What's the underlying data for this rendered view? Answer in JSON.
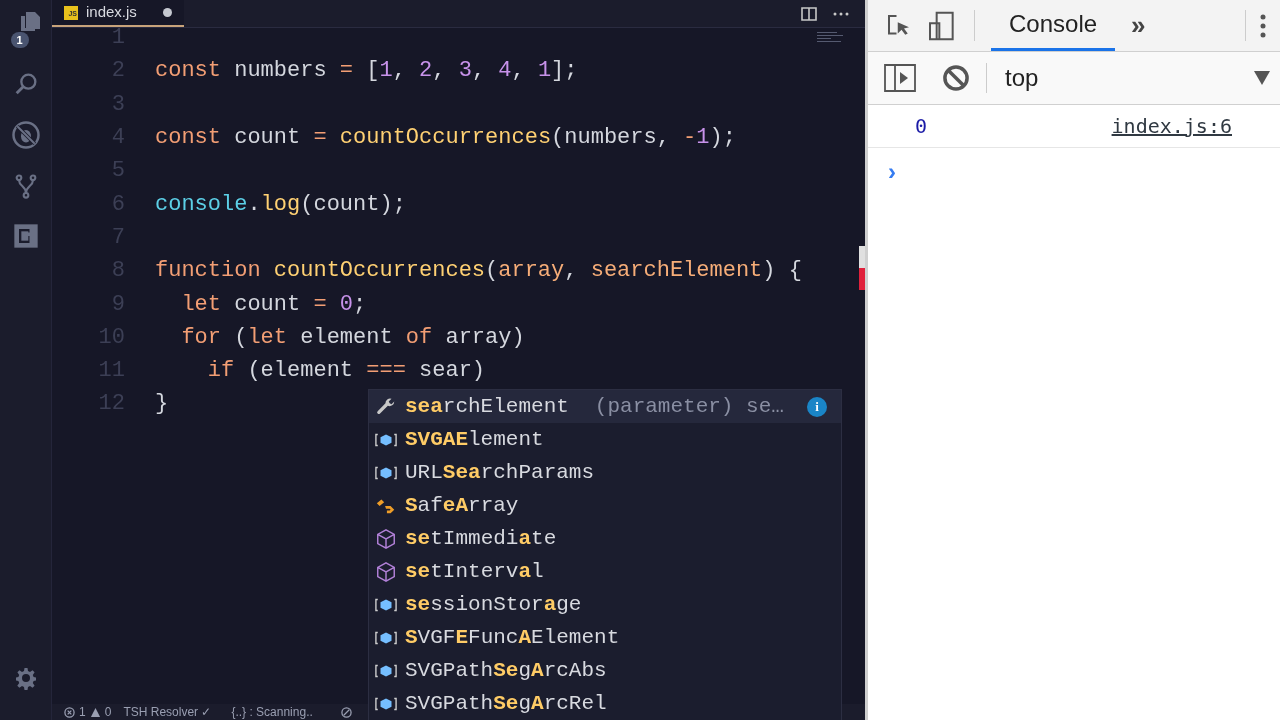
{
  "activity_bar": {
    "explorer_badge": "1"
  },
  "editor": {
    "tab": {
      "label": "index.js",
      "badge": "JS",
      "dirty": true
    },
    "lines": [
      {
        "number": "1"
      },
      {
        "number": "2",
        "tokens": [
          {
            "t": "const",
            "kind": "keyword"
          },
          {
            "t": " numbers ",
            "kind": "plain"
          },
          {
            "t": "=",
            "kind": "op"
          },
          {
            "t": " [",
            "kind": "plain"
          },
          {
            "t": "1",
            "kind": "number"
          },
          {
            "t": ", ",
            "kind": "plain"
          },
          {
            "t": "2",
            "kind": "number"
          },
          {
            "t": ", ",
            "kind": "plain"
          },
          {
            "t": "3",
            "kind": "number"
          },
          {
            "t": ", ",
            "kind": "plain"
          },
          {
            "t": "4",
            "kind": "number"
          },
          {
            "t": ", ",
            "kind": "plain"
          },
          {
            "t": "1",
            "kind": "number"
          },
          {
            "t": "];",
            "kind": "plain"
          }
        ]
      },
      {
        "number": "3"
      },
      {
        "number": "4",
        "tokens": [
          {
            "t": "const",
            "kind": "keyword"
          },
          {
            "t": " count ",
            "kind": "plain"
          },
          {
            "t": "=",
            "kind": "op"
          },
          {
            "t": " countOccurrences",
            "kind": "func"
          },
          {
            "t": "(numbers, ",
            "kind": "plain"
          },
          {
            "t": "-",
            "kind": "op"
          },
          {
            "t": "1",
            "kind": "number"
          },
          {
            "t": ");",
            "kind": "plain"
          }
        ]
      },
      {
        "number": "5"
      },
      {
        "number": "6",
        "tokens": [
          {
            "t": "console",
            "kind": "builtin"
          },
          {
            "t": ".",
            "kind": "plain"
          },
          {
            "t": "log",
            "kind": "func"
          },
          {
            "t": "(count);",
            "kind": "plain"
          }
        ]
      },
      {
        "number": "7"
      },
      {
        "number": "8",
        "tokens": [
          {
            "t": "function",
            "kind": "keyword"
          },
          {
            "t": " countOccurrences",
            "kind": "func"
          },
          {
            "t": "(",
            "kind": "plain"
          },
          {
            "t": "array",
            "kind": "param"
          },
          {
            "t": ", ",
            "kind": "plain"
          },
          {
            "t": "searchElement",
            "kind": "param"
          },
          {
            "t": ") {",
            "kind": "plain"
          }
        ]
      },
      {
        "number": "9",
        "tokens": [
          {
            "t": "  let",
            "kind": "keyword"
          },
          {
            "t": " count ",
            "kind": "plain"
          },
          {
            "t": "=",
            "kind": "op"
          },
          {
            "t": " 0",
            "kind": "number"
          },
          {
            "t": ";",
            "kind": "plain"
          }
        ]
      },
      {
        "number": "10",
        "tokens": [
          {
            "t": "  for",
            "kind": "keyword"
          },
          {
            "t": " (",
            "kind": "plain"
          },
          {
            "t": "let",
            "kind": "keyword"
          },
          {
            "t": " element ",
            "kind": "plain"
          },
          {
            "t": "of",
            "kind": "keyword"
          },
          {
            "t": " array)",
            "kind": "plain"
          }
        ]
      },
      {
        "number": "11",
        "tokens": [
          {
            "t": "    if",
            "kind": "keyword"
          },
          {
            "t": " (element ",
            "kind": "plain"
          },
          {
            "t": "===",
            "kind": "op"
          },
          {
            "t": " sear)",
            "kind": "plain"
          }
        ]
      },
      {
        "number": "12",
        "tokens": [
          {
            "t": "}",
            "kind": "plain"
          }
        ]
      }
    ],
    "suggestions": [
      {
        "kind": "variable",
        "selected": true,
        "label": "**sea**rchElement",
        "detail": "(parameter) se…",
        "info": "i"
      },
      {
        "kind": "class",
        "selected": false,
        "label": "**SVGAE**lement"
      },
      {
        "kind": "class",
        "selected": false,
        "label": "URL**Sea**rchParams"
      },
      {
        "kind": "interface",
        "selected": false,
        "label": "**S**af**eA**rray"
      },
      {
        "kind": "function",
        "selected": false,
        "label": "**se**tImmedi**a**te"
      },
      {
        "kind": "function",
        "selected": false,
        "label": "**se**tInterv**a**l"
      },
      {
        "kind": "class",
        "selected": false,
        "label": "**se**ssionStor**a**ge"
      },
      {
        "kind": "class",
        "selected": false,
        "label": "**S**VGF**E**Func**A**Element"
      },
      {
        "kind": "class",
        "selected": false,
        "label": "SVGPath**Se**g**A**rcAbs"
      },
      {
        "kind": "class",
        "selected": false,
        "label": "SVGPath**Se**g**A**rcRel"
      }
    ]
  },
  "status_bar": {
    "errors": "1",
    "warnings": "0",
    "resolver": "TSH Resolver ✓",
    "scanning": "{..} : Scanning.."
  },
  "devtools": {
    "tabs": [
      {
        "label": "Console",
        "selected": true
      }
    ],
    "more": "»",
    "context": "top",
    "messages": [
      {
        "value": "0",
        "source": "index.js:6"
      }
    ],
    "prompt": "›"
  }
}
